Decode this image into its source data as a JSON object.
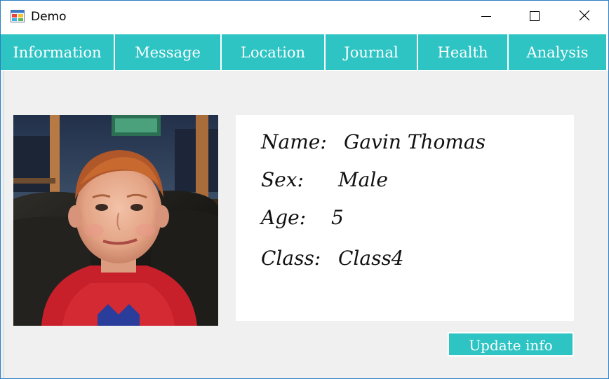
{
  "window": {
    "title": "Demo",
    "controls": {
      "minimize_icon": "minimize-icon",
      "maximize_icon": "maximize-icon",
      "close_icon": "close-icon"
    }
  },
  "tabs": [
    {
      "label": "Information"
    },
    {
      "label": "Message"
    },
    {
      "label": "Location"
    },
    {
      "label": "Journal"
    },
    {
      "label": "Health"
    },
    {
      "label": "Analysis"
    }
  ],
  "profile": {
    "photo_description_icon": "profile-photo",
    "name_label": "Name:",
    "name_value": "Gavin Thomas",
    "sex_label": "Sex:",
    "sex_value": "Male",
    "age_label": "Age:",
    "age_value": "5",
    "class_label": "Class:",
    "class_value": "Class4"
  },
  "actions": {
    "update_label": "Update info"
  },
  "colors": {
    "accent": "#2ec4c4",
    "window_border": "#2b7fc4",
    "content_bg": "#f0f0f0",
    "card_bg": "#ffffff"
  }
}
